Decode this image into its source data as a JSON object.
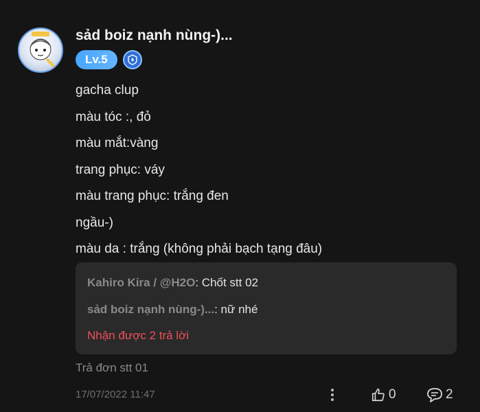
{
  "post": {
    "author": "sảd boiz nạnh nùng-)...",
    "level": "Lv.5",
    "lines": [
      "gacha clup",
      "màu tóc :, đỏ",
      "màu mắt:vàng",
      "trang phục: váy",
      "màu trang phục: trắng đen",
      "ngầu-)",
      "màu da : trắng (không phải bạch tạng đâu)"
    ],
    "replies": [
      {
        "author": "Kahiro Kira / @H2O",
        "text": ": Chốt stt 02"
      },
      {
        "author": "sảd boiz nạnh nùng-)...",
        "text": ": nữ nhé"
      }
    ],
    "more_replies": "Nhận được 2 trả lời",
    "status": "Trả đơn stt 01",
    "timestamp": "17/07/2022 11:47",
    "likes": "0",
    "comments": "2"
  },
  "colors": {
    "background": "#151515",
    "reply_box": "#2a2a2a",
    "level_badge": "#4aa6ff",
    "more_replies": "#f0505a"
  }
}
